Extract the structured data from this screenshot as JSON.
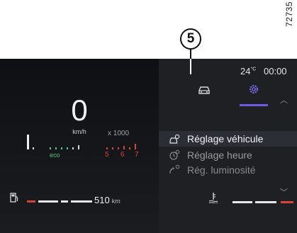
{
  "figure_ref": "72735",
  "callout": "5",
  "status": {
    "temperature": "24",
    "temperature_unit": "°C",
    "time": "00:00"
  },
  "speed": {
    "value": "0",
    "unit": "km/h"
  },
  "rpm": {
    "scale_label": "x 1000",
    "eco_label": "eco",
    "redline_marks": [
      "5",
      "6",
      "7"
    ]
  },
  "range": {
    "value": "510",
    "unit": "km",
    "fuel_level_fraction": 0.5
  },
  "tabs": [
    {
      "icon": "car-icon"
    },
    {
      "icon": "gear-icon",
      "selected": true
    }
  ],
  "menu": {
    "items": [
      {
        "label": "Réglage véhicule",
        "icon": "car-settings-icon",
        "selected": true
      },
      {
        "label": "Réglage heure",
        "icon": "clock-settings-icon",
        "selected": false
      },
      {
        "label": "Rég. luminosité",
        "icon": "brightness-icon",
        "selected": false
      }
    ]
  },
  "colors": {
    "accent": "#6b5be0",
    "eco": "#4ec183",
    "warning": "#d9423a",
    "background": "#1e2024"
  }
}
